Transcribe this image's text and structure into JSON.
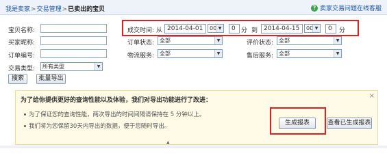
{
  "breadcrumb": {
    "item1": "我是卖家",
    "item2": "交易管理",
    "item3": "已卖出的宝贝",
    "sep": ">"
  },
  "help": {
    "icon": "question-icon",
    "text": "卖家交易问题在线客服"
  },
  "filters": {
    "item_name_label": "宝贝名称:",
    "buyer_nick_label": "买家昵称:",
    "order_no_label": "订单编号:",
    "trade_type_label": "交易类型:",
    "trade_type_value": "所有类型",
    "order_status_label": "订单状态:",
    "order_status_value": "全部",
    "logistics_label": "物流服务:",
    "logistics_value": "全部",
    "review_status_label": "评价状态:",
    "review_status_value": "全部",
    "after_sale_label": "售后服务:",
    "after_sale_value": "全部",
    "time_label": "成交时间:",
    "from_label": "从",
    "from_date": "2014-04-01",
    "from_hour": "00",
    "from_min": "0",
    "to_label": "到",
    "to_date": "2014-04-15",
    "to_hour": "00",
    "to_min": "0",
    "minute_unit": "分"
  },
  "buttons": {
    "search": "搜索",
    "bulk_export": "批量导出"
  },
  "notice": {
    "title": "为了给你提供更好的查询性能以及体验，我们对导出功能进行了改进：",
    "items": [
      "为了保证您的查询性能，两次导出的时间间隔请保持在 5 分钟以上。",
      "我们将为您保留30天内导出的数据，便于您随时导出。"
    ],
    "generate_report": "生成报表",
    "view_reports": "查看已生成报表",
    "close": "×"
  },
  "accent_color": "#e02020"
}
